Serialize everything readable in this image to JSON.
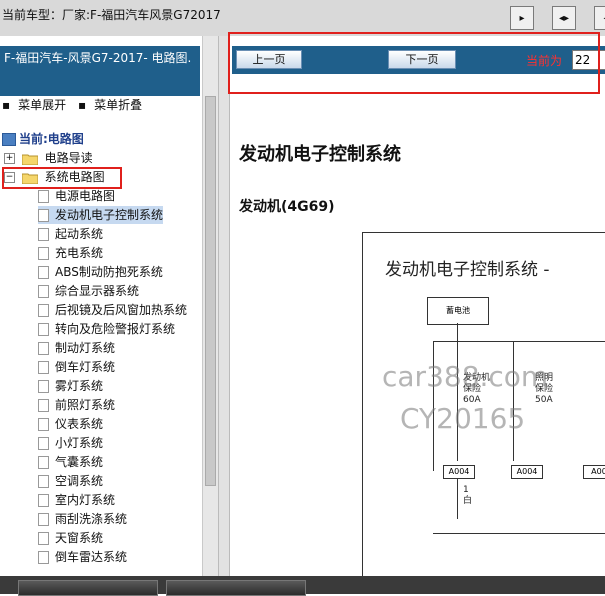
{
  "top": {
    "title": "当前车型：厂家:F-福田汽车风景G72017",
    "buttons": [
      "▸",
      "◂▸",
      "◂"
    ]
  },
  "left": {
    "header": "F-福田汽车-风景G7-2017- 电路图.",
    "expand_all": "菜单展开",
    "collapse_all": "菜单折叠",
    "current_label": "当前:电路图",
    "tree_groups": [
      "电路导读",
      "系统电路图"
    ],
    "items": [
      "电源电路图",
      "发动机电子控制系统",
      "起动系统",
      "充电系统",
      "ABS制动防抱死系统",
      "综合显示器系统",
      "后视镜及后风窗加热系统",
      "转向及危险警报灯系统",
      "制动灯系统",
      "倒车灯系统",
      "雾灯系统",
      "前照灯系统",
      "仪表系统",
      "小灯系统",
      "气囊系统",
      "空调系统",
      "室内灯系统",
      "雨刮洗涤系统",
      "天窗系统",
      "倒车雷达系统"
    ]
  },
  "nav": {
    "prev": "上一页",
    "next": "下一页",
    "current_label": "当前为",
    "current_value": "22"
  },
  "content": {
    "title": "发动机电子控制系统",
    "subtitle": "发动机(4G69)",
    "diagram_title": "发动机电子控制系统 -",
    "battery": "蓄电池",
    "fuse1": [
      "发动机",
      "保险",
      "60A"
    ],
    "fuse2": [
      "照明",
      "保险",
      "50A"
    ],
    "conn1": "A004",
    "conn2": "A004",
    "conn3": "A00",
    "wire_label": [
      "1",
      "白"
    ],
    "watermark1": "car388.com",
    "watermark2": "CY20165"
  }
}
